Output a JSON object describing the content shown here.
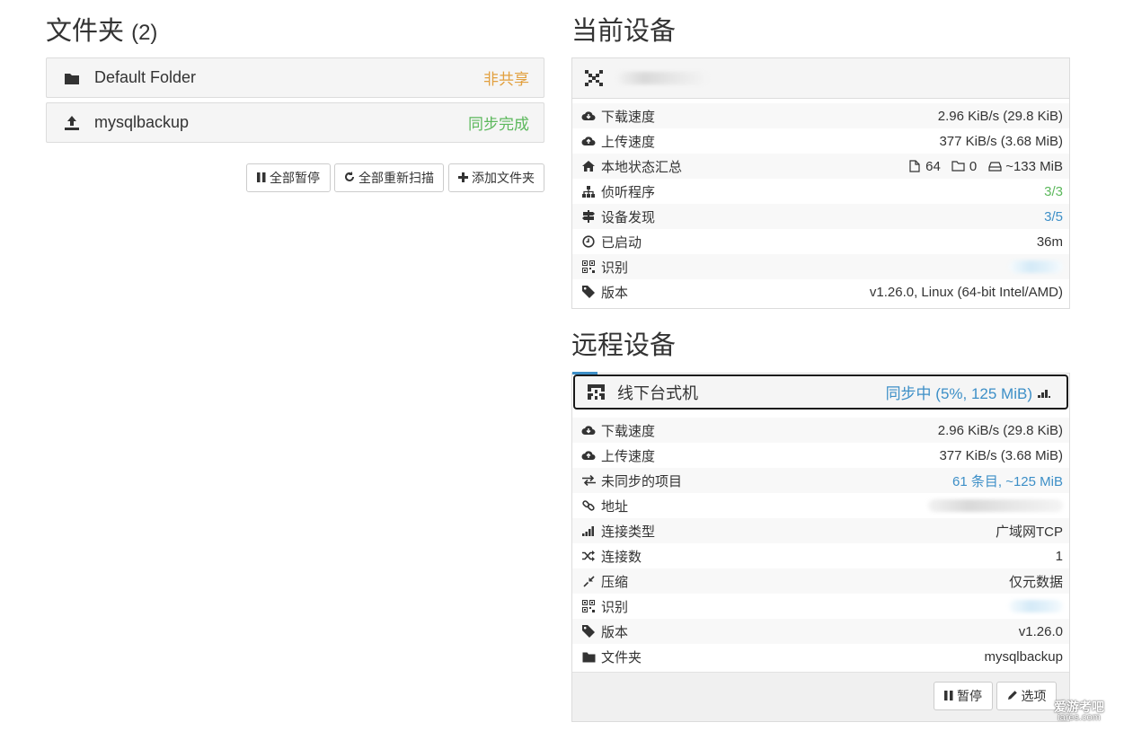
{
  "folders": {
    "title": "文件夹",
    "count": "(2)",
    "items": [
      {
        "icon": "folder-icon",
        "name": "Default Folder",
        "status": "非共享",
        "status_color": "#e2a03f"
      },
      {
        "icon": "upload-icon",
        "name": "mysqlbackup",
        "status": "同步完成",
        "status_color": "#5cb85c"
      }
    ],
    "buttons": {
      "pause_all": "全部暂停",
      "rescan_all": "全部重新扫描",
      "add_folder": "添加文件夹"
    }
  },
  "this_device": {
    "title": "当前设备",
    "rows": [
      {
        "icon": "cloud-download-icon",
        "label": "下载速度",
        "value": "2.96 KiB/s (29.8 KiB)"
      },
      {
        "icon": "cloud-upload-icon",
        "label": "上传速度",
        "value": "377 KiB/s (3.68 MiB)"
      },
      {
        "icon": "home-icon",
        "label": "本地状态汇总",
        "files": "64",
        "dirs": "0",
        "size": "~133 MiB"
      },
      {
        "icon": "sitemap-icon",
        "label": "侦听程序",
        "value": "3/3"
      },
      {
        "icon": "signpost-icon",
        "label": "设备发现",
        "value": "3/5"
      },
      {
        "icon": "clock-icon",
        "label": "已启动",
        "value": "36m"
      },
      {
        "icon": "qrcode-icon",
        "label": "识别",
        "value": ""
      },
      {
        "icon": "tag-icon",
        "label": "版本",
        "value": "v1.26.0, Linux (64-bit Intel/AMD)"
      }
    ]
  },
  "remote_devices": {
    "title": "远程设备",
    "device": {
      "name": "线下台式机",
      "status": "同步中 (5%, 125 MiB)",
      "sync_percent": 5,
      "rows": [
        {
          "icon": "cloud-download-icon",
          "label": "下载速度",
          "value": "2.96 KiB/s (29.8 KiB)"
        },
        {
          "icon": "cloud-upload-icon",
          "label": "上传速度",
          "value": "377 KiB/s (3.68 MiB)"
        },
        {
          "icon": "exchange-icon",
          "label": "未同步的项目",
          "value": "61 条目, ~125 MiB"
        },
        {
          "icon": "link-icon",
          "label": "地址",
          "value": ""
        },
        {
          "icon": "signal-icon",
          "label": "连接类型",
          "value": "广域网TCP"
        },
        {
          "icon": "random-icon",
          "label": "连接数",
          "value": "1"
        },
        {
          "icon": "compress-icon",
          "label": "压缩",
          "value": "仅元数据"
        },
        {
          "icon": "qrcode-icon",
          "label": "识别",
          "value": ""
        },
        {
          "icon": "tag-icon",
          "label": "版本",
          "value": "v1.26.0"
        },
        {
          "icon": "folder-icon",
          "label": "文件夹",
          "value": "mysqlbackup"
        }
      ],
      "buttons": {
        "pause": "暂停",
        "options": "选项"
      }
    }
  },
  "watermark": {
    "line1": "爱游考吧",
    "line2": "iares.com"
  },
  "colors": {
    "accent_blue": "#3d8fc7",
    "green": "#5cb85c",
    "orange": "#e2a03f"
  }
}
